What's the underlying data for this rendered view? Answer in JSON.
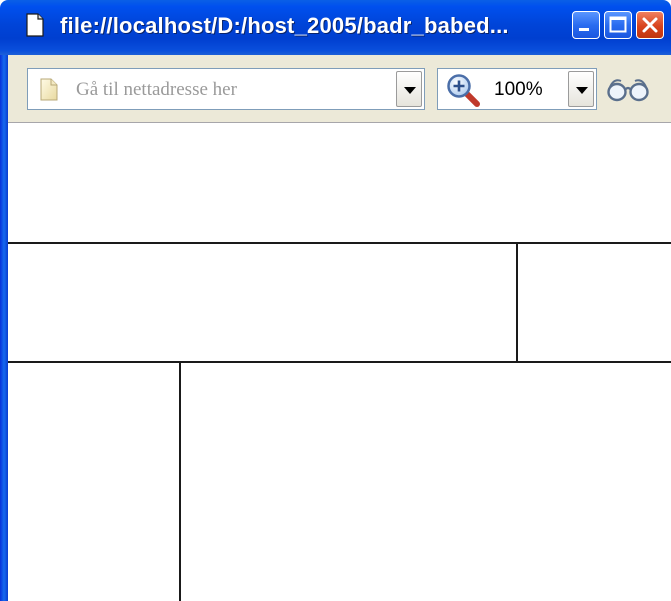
{
  "window": {
    "title": "file://localhost/D:/host_2005/badr_babed..."
  },
  "title_buttons": {
    "minimize": "minimize-icon",
    "maximize": "maximize-icon",
    "close": "close-icon"
  },
  "toolbar": {
    "address_placeholder": "Gå til nettadresse her",
    "zoom_value": "100%",
    "icons": {
      "page": "page-icon",
      "zoom": "magnifier-zoom-icon",
      "dropdown": "chevron-down-icon",
      "reader": "glasses-icon"
    }
  },
  "colors": {
    "titlebar": "#0044d8",
    "toolbar": "#ece9d8",
    "close_button": "#d8431c",
    "frame_border": "#000000"
  }
}
